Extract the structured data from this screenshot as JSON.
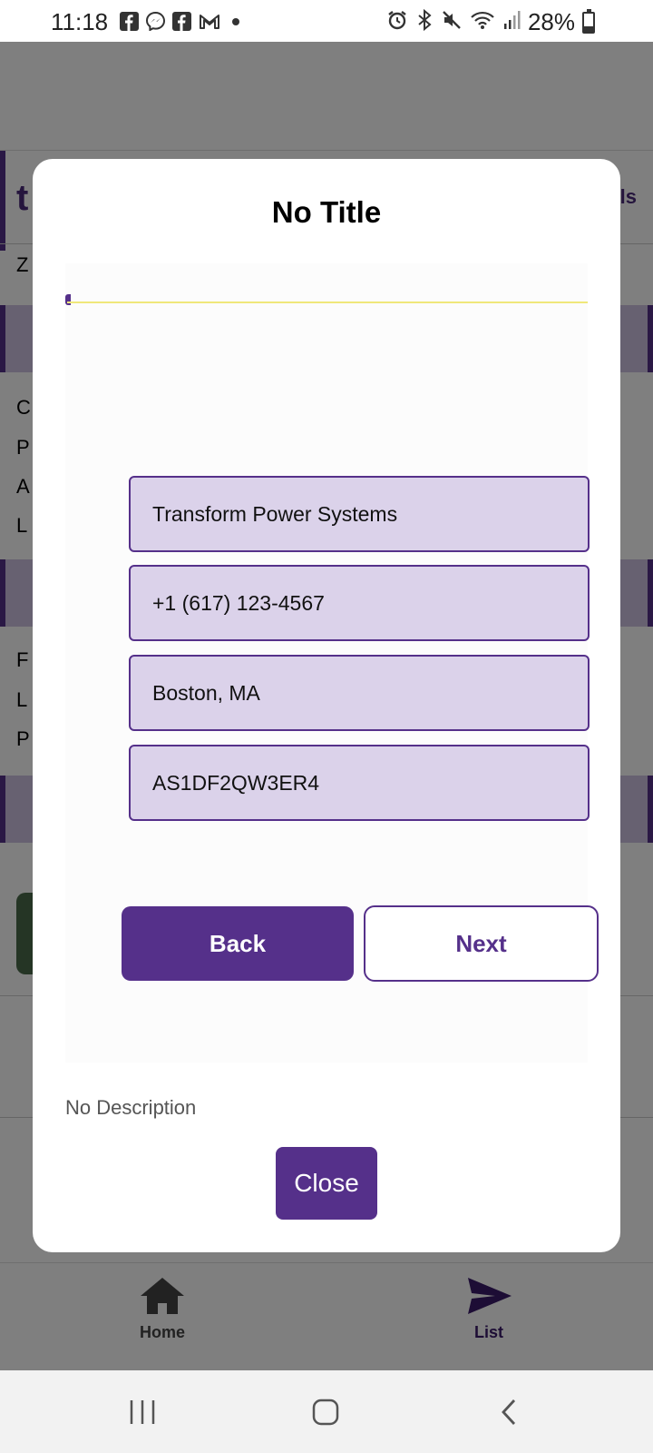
{
  "status_bar": {
    "time": "11:18",
    "battery_text": "28%",
    "battery_level": 0.28,
    "left_icons": [
      "facebook-icon",
      "messenger-icon",
      "facebook-icon",
      "gmail-icon"
    ],
    "right_icons": [
      "alarm-icon",
      "bluetooth-icon",
      "mute-icon",
      "wifi-icon",
      "signal-icon",
      "battery-icon"
    ]
  },
  "modal": {
    "title": "No Title",
    "fields": [
      {
        "value": "Transform Power Systems"
      },
      {
        "value": "+1 (617) 123-4567"
      },
      {
        "value": "Boston, MA"
      },
      {
        "value": "AS1DF2QW3ER4"
      }
    ],
    "back_label": "Back",
    "next_label": "Next",
    "description": "No Description",
    "close_label": "Close"
  },
  "bottom_nav": {
    "items": [
      {
        "label": "Home",
        "icon": "home-icon"
      },
      {
        "label": "List",
        "icon": "send-icon"
      }
    ]
  },
  "colors": {
    "accent": "#55308a",
    "field_bg": "#dbd2ea",
    "scrim": "rgba(0,0,0,0.5)"
  }
}
